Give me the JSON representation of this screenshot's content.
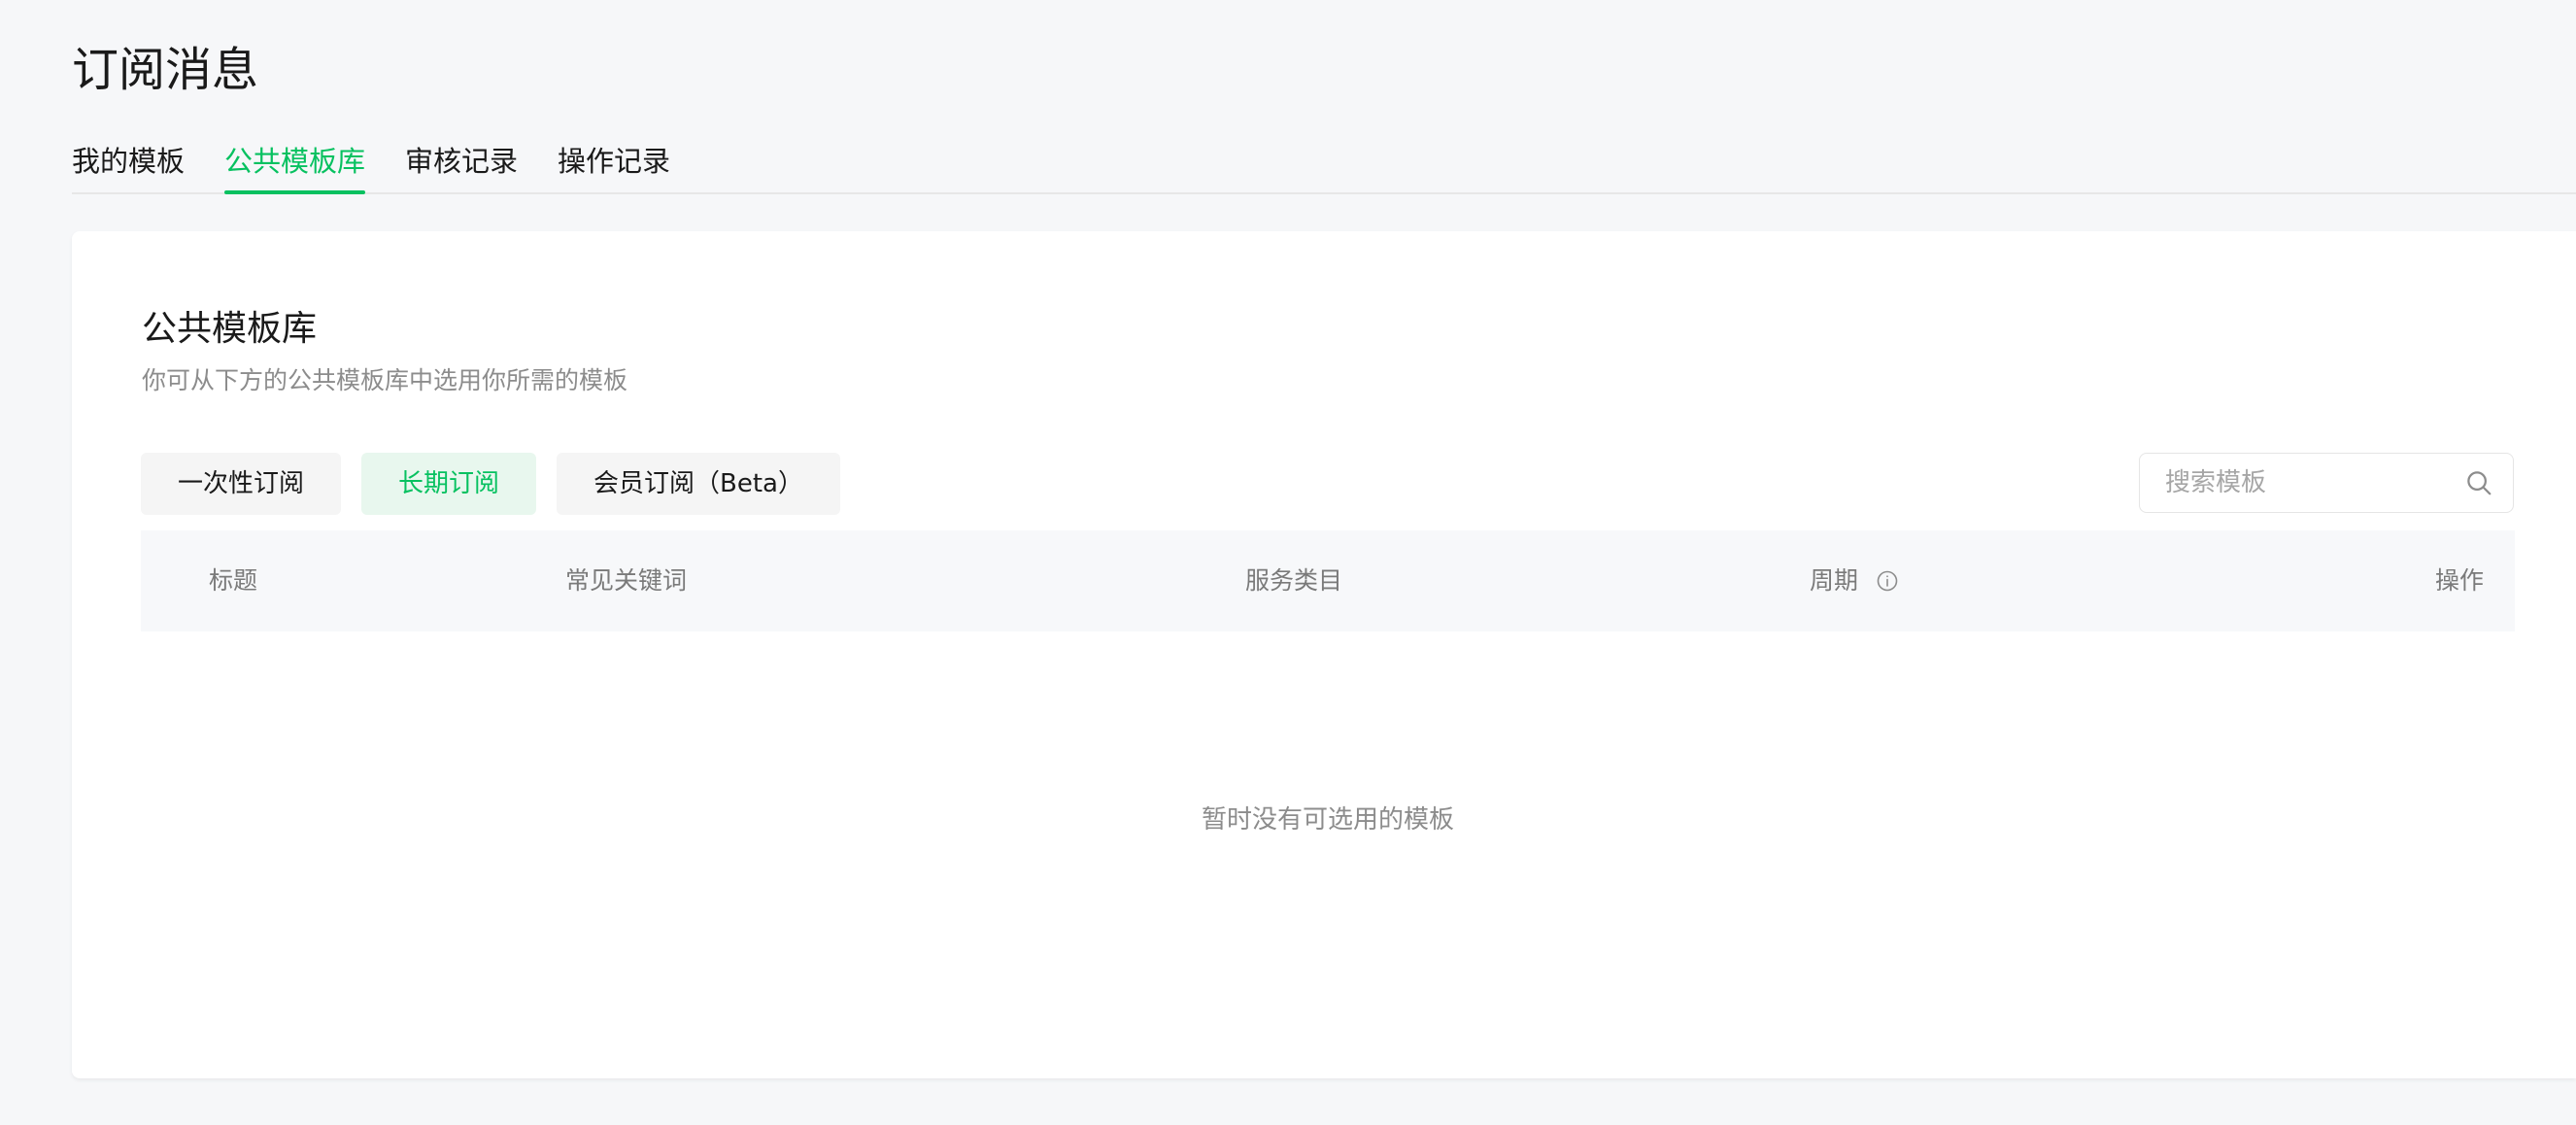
{
  "page": {
    "title": "订阅消息"
  },
  "tabs": [
    {
      "label": "我的模板",
      "active": false
    },
    {
      "label": "公共模板库",
      "active": true
    },
    {
      "label": "审核记录",
      "active": false
    },
    {
      "label": "操作记录",
      "active": false
    }
  ],
  "section": {
    "title": "公共模板库",
    "description": "你可从下方的公共模板库中选用你所需的模板"
  },
  "filters": [
    {
      "label": "一次性订阅",
      "active": false
    },
    {
      "label": "长期订阅",
      "active": true
    },
    {
      "label": "会员订阅（Beta）",
      "active": false
    }
  ],
  "search": {
    "placeholder": "搜索模板",
    "value": "",
    "icon": "search-icon"
  },
  "table": {
    "columns": {
      "title": "标题",
      "keywords": "常见关键词",
      "category": "服务类目",
      "period": "周期",
      "action": "操作"
    },
    "period_icon": "info-icon",
    "rows": [],
    "empty_text": "暂时没有可选用的模板"
  },
  "colors": {
    "accent": "#07c160",
    "accent_bg": "#e8f7ee",
    "background": "#f6f7f9",
    "muted_text": "#8c8c8c"
  }
}
